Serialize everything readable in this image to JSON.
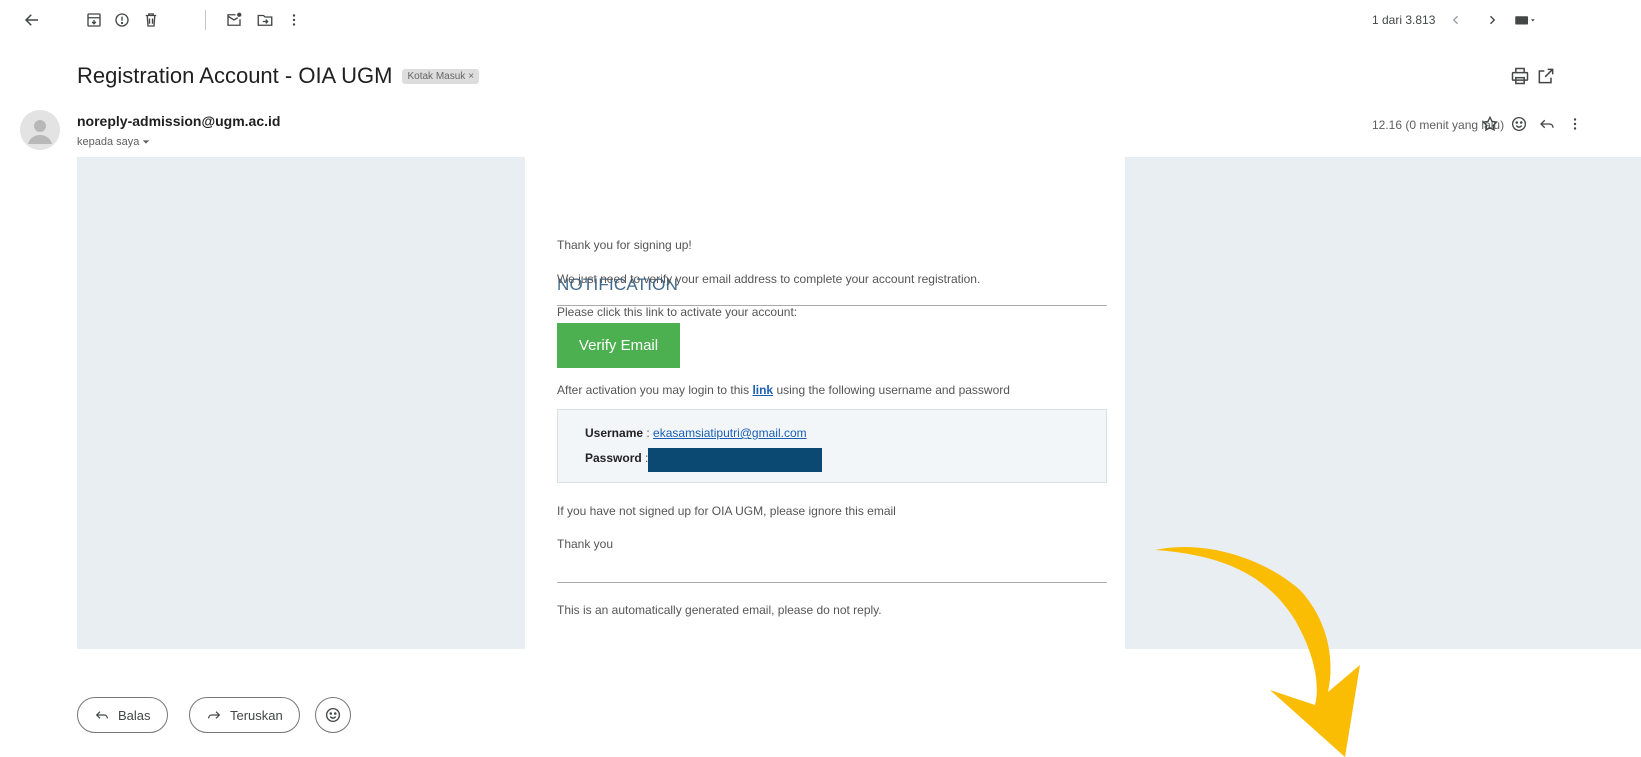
{
  "pager": {
    "text": "1 dari 3.813"
  },
  "subject": {
    "title": "Registration Account - OIA UGM",
    "label": "Kotak Masuk",
    "label_close": "×"
  },
  "sender": {
    "email": "noreply-admission@ugm.ac.id",
    "recipient": "kepada saya",
    "timestamp": "12.16 (0 menit yang lalu)"
  },
  "email": {
    "heading": "NOTIFICATION",
    "thanks_signup": "Thank you for signing up!",
    "verify_need": "We just need to verify your email address to complete your account registration.",
    "click_link": "Please click this link to activate your account:",
    "verify_button": "Verify Email",
    "after_activation_pre": "After activation you may login to this",
    "after_activation_link": "link",
    "after_activation_post": "using the following username and password",
    "username_label": "Username",
    "username_value": "ekasamsiatiputri@gmail.com",
    "password_label": "Password",
    "separator": " : ",
    "ignore_text": "If you have not signed up for OIA UGM, please ignore this email",
    "thank_you": "Thank you",
    "auto_generated": "This is an automatically generated email, please do not reply."
  },
  "actions": {
    "reply": "Balas",
    "forward": "Teruskan"
  },
  "colors": {
    "verify_green": "#4caf50",
    "heading_blue": "#426b8c",
    "redaction": "#0b4872",
    "arrow_yellow": "#fbbc04",
    "email_bg": "#e9eef2"
  },
  "icons": {
    "toolbar": [
      "back-arrow-icon",
      "archive-icon",
      "report-spam-icon",
      "delete-icon",
      "mark-unread-icon",
      "move-to-icon",
      "more-vert-icon"
    ],
    "pager": [
      "chevron-left-icon",
      "chevron-right-icon",
      "keyboard-icon"
    ],
    "header": [
      "print-icon",
      "open-new-window-icon",
      "star-icon",
      "emoji-icon",
      "reply-icon",
      "more-vert-icon"
    ]
  }
}
